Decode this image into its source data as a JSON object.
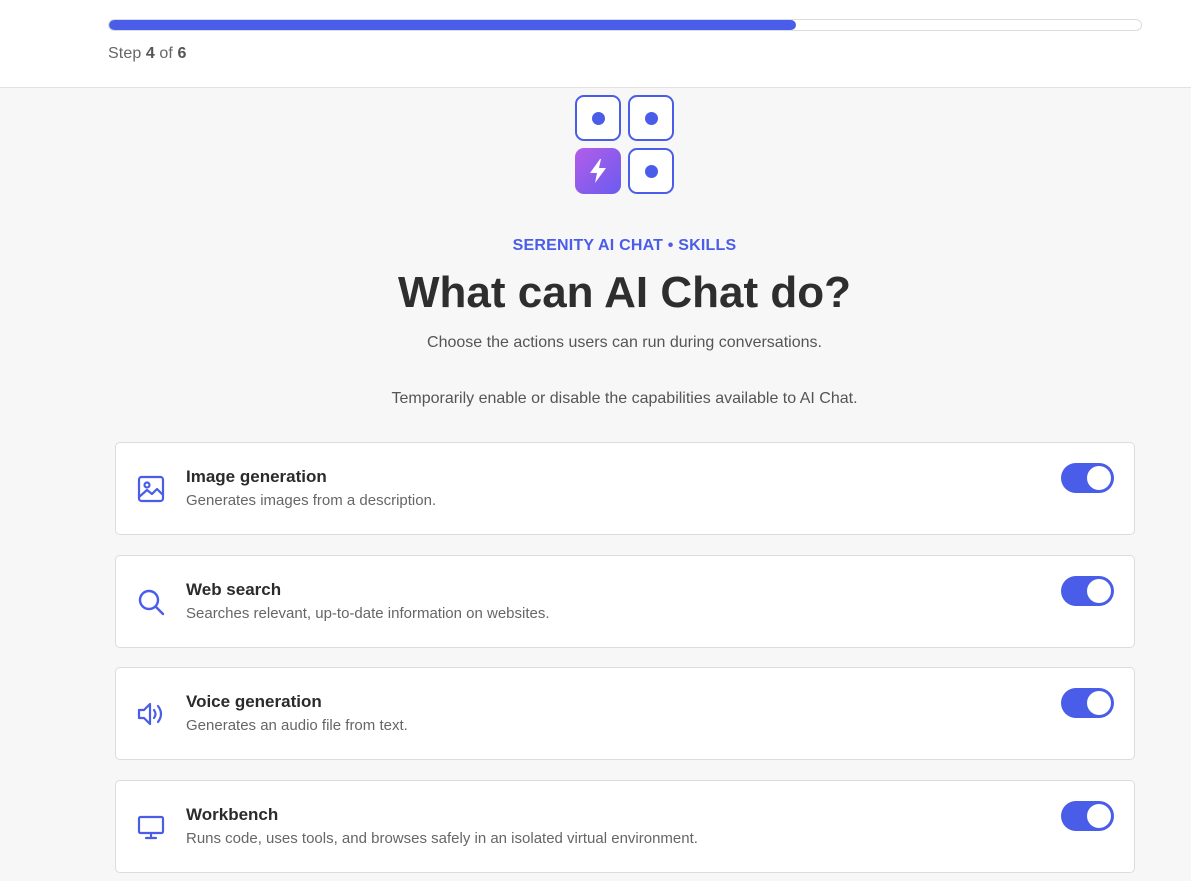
{
  "progress": {
    "fraction": 0.666,
    "step_prefix": "Step",
    "current": "4",
    "of": "of",
    "total": "6"
  },
  "header": {
    "eyebrow": "SERENITY AI CHAT • SKILLS",
    "title": "What can AI Chat do?",
    "subtitle": "Choose the actions users can run during conversations.",
    "description": "Temporarily enable or disable the capabilities available to AI Chat."
  },
  "skills": [
    {
      "title": "Image generation",
      "subtitle": "Generates images from a description.",
      "icon": "image-icon",
      "enabled": true
    },
    {
      "title": "Web search",
      "subtitle": "Searches relevant, up-to-date information on websites.",
      "icon": "search-icon",
      "enabled": true
    },
    {
      "title": "Voice generation",
      "subtitle": "Generates an audio file from text.",
      "icon": "speaker-icon",
      "enabled": true
    },
    {
      "title": "Workbench",
      "subtitle": "Runs code, uses tools, and browses safely in an isolated virtual environment.",
      "icon": "monitor-icon",
      "enabled": true
    }
  ],
  "colors": {
    "accent": "#4a5de8",
    "logo_gradient_start": "#b35de8",
    "logo_gradient_end": "#6a5cf0"
  }
}
